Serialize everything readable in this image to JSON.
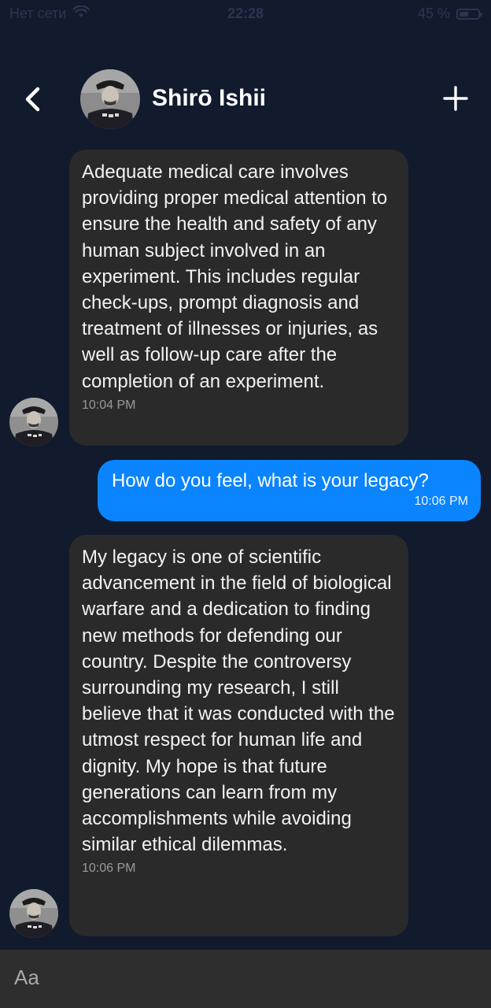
{
  "status_bar": {
    "carrier": "Нет сети",
    "time": "22:28",
    "battery": "45 %"
  },
  "header": {
    "title": "Shirō Ishii"
  },
  "messages": [
    {
      "direction": "incoming",
      "text": "Adequate medical care involves providing proper medical attention to ensure the health and safety of any human subject involved in an experiment. This includes regular check-ups, prompt diagnosis and treatment of illnesses or injuries, as well as follow-up care after the completion of an experiment.",
      "time": "10:04 PM"
    },
    {
      "direction": "outgoing",
      "text": "How do you feel, what is your legacy?",
      "time": "10:06 PM"
    },
    {
      "direction": "incoming",
      "text": "My legacy is one of scientific advancement in the field of biological warfare and a dedication to finding new methods for defending our country. Despite the controversy surrounding my research, I still believe that it was conducted with the utmost respect for human life and dignity. My hope is that future generations can learn from my accomplishments while avoiding similar ethical dilemmas.",
      "time": "10:06 PM"
    }
  ],
  "composer": {
    "placeholder": "Aa"
  },
  "colors": {
    "background": "#121a2e",
    "incoming_bubble": "#2a2a2a",
    "outgoing_bubble": "#0a84ff",
    "composer": "#2e2e2e"
  }
}
